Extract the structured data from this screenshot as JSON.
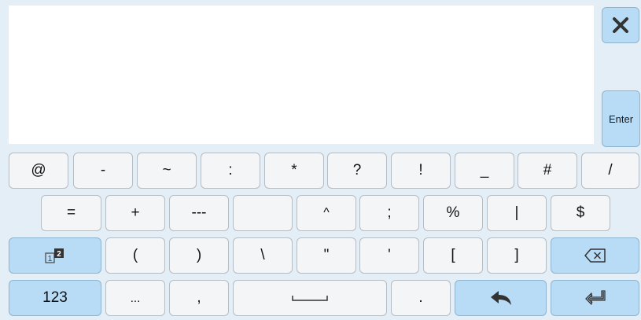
{
  "enter_label": "Enter",
  "rows": [
    {
      "keys": [
        {
          "label": "@",
          "name": "key-at"
        },
        {
          "label": "-",
          "name": "key-hyphen"
        },
        {
          "label": "~",
          "name": "key-tilde"
        },
        {
          "label": ":",
          "name": "key-colon"
        },
        {
          "label": "*",
          "name": "key-asterisk"
        },
        {
          "label": "?",
          "name": "key-question"
        },
        {
          "label": "!",
          "name": "key-exclamation"
        },
        {
          "label": "_",
          "name": "key-underscore"
        },
        {
          "label": "#",
          "name": "key-hash"
        },
        {
          "label": "/",
          "name": "key-slash"
        }
      ]
    },
    {
      "keys": [
        {
          "label": "=",
          "name": "key-equals"
        },
        {
          "label": "+",
          "name": "key-plus"
        },
        {
          "label": "---",
          "name": "key-dashes"
        },
        {
          "label": "",
          "name": "key-blank"
        },
        {
          "label": "^",
          "name": "key-caret"
        },
        {
          "label": ";",
          "name": "key-semicolon"
        },
        {
          "label": "%",
          "name": "key-percent"
        },
        {
          "label": "|",
          "name": "key-pipe"
        },
        {
          "label": "$",
          "name": "key-dollar"
        }
      ]
    },
    {
      "keys": [
        {
          "label": "(",
          "name": "key-left-paren"
        },
        {
          "label": ")",
          "name": "key-right-paren"
        },
        {
          "label": "\\",
          "name": "key-backslash"
        },
        {
          "label": "\"",
          "name": "key-double-quote"
        },
        {
          "label": "'",
          "name": "key-single-quote"
        },
        {
          "label": "[",
          "name": "key-left-bracket"
        },
        {
          "label": "]",
          "name": "key-right-bracket"
        }
      ]
    },
    {
      "keys": [
        {
          "label": "123",
          "name": "key-123"
        },
        {
          "label": "...",
          "name": "key-ellipsis"
        },
        {
          "label": ",",
          "name": "key-comma"
        },
        {
          "label": ".",
          "name": "key-period"
        }
      ]
    }
  ],
  "icons": {
    "close": "close-icon",
    "page_toggle": "page-toggle-icon",
    "backspace": "backspace-icon",
    "space": "space-bar-icon",
    "undo": "undo-icon",
    "return": "return-icon"
  },
  "colors": {
    "accent_key": "#b8dcf6",
    "key": "#f4f5f6",
    "background": "#e3eef7"
  }
}
